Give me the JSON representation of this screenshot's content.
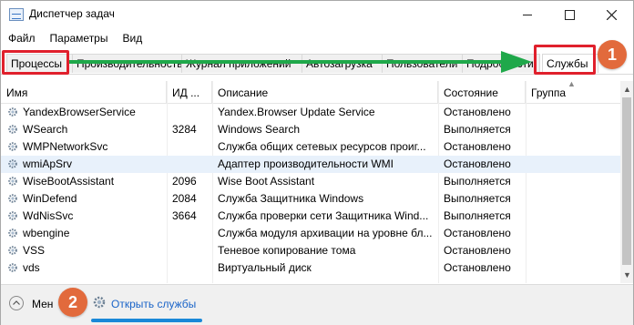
{
  "window": {
    "title": "Диспетчер задач"
  },
  "menu": [
    "Файл",
    "Параметры",
    "Вид"
  ],
  "tabs": [
    "Процессы",
    "Производительность",
    "Журнал приложений",
    "Автозагрузка",
    "Пользователи",
    "Подробности",
    "Службы"
  ],
  "columns": {
    "name": "Имя",
    "pid": "ИД ...",
    "description": "Описание",
    "status": "Состояние",
    "group": "Группа"
  },
  "rows": [
    {
      "name": "YandexBrowserService",
      "pid": "",
      "description": "Yandex.Browser Update Service",
      "status": "Остановлено"
    },
    {
      "name": "WSearch",
      "pid": "3284",
      "description": "Windows Search",
      "status": "Выполняется"
    },
    {
      "name": "WMPNetworkSvc",
      "pid": "",
      "description": "Служба общих сетевых ресурсов проиг...",
      "status": "Остановлено"
    },
    {
      "name": "wmiApSrv",
      "pid": "",
      "description": "Адаптер производительности WMI",
      "status": "Остановлено"
    },
    {
      "name": "WiseBootAssistant",
      "pid": "2096",
      "description": "Wise Boot Assistant",
      "status": "Выполняется"
    },
    {
      "name": "WinDefend",
      "pid": "2084",
      "description": "Служба Защитника Windows",
      "status": "Выполняется"
    },
    {
      "name": "WdNisSvc",
      "pid": "3664",
      "description": "Служба проверки сети Защитника Wind...",
      "status": "Выполняется"
    },
    {
      "name": "wbengine",
      "pid": "",
      "description": "Служба модуля архивации на уровне бл...",
      "status": "Остановлено"
    },
    {
      "name": "VSS",
      "pid": "",
      "description": "Теневое копирование тома",
      "status": "Остановлено"
    },
    {
      "name": "vds",
      "pid": "",
      "description": "Виртуальный диск",
      "status": "Остановлено"
    }
  ],
  "footer": {
    "less_label": "Мен",
    "open_services_label": "Открыть службы"
  },
  "annotations": {
    "badge1": "1",
    "badge2": "2",
    "highlight_color": "#e0202c",
    "arrow_color": "#1fa84a",
    "badge_color": "#e26a3c"
  }
}
